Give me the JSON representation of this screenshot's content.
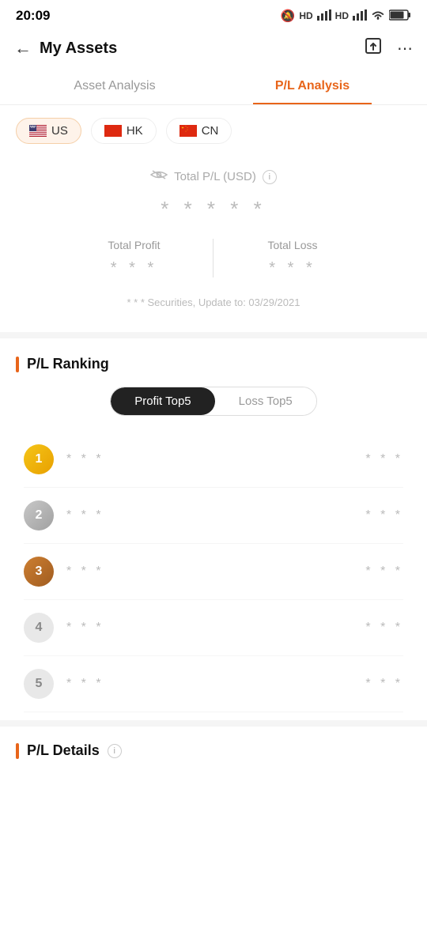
{
  "statusBar": {
    "time": "20:09",
    "icons": "🔕 HD HD ▲▲▲ ▲▲▲ ⊙ 71"
  },
  "header": {
    "title": "My Assets",
    "backLabel": "←",
    "shareIcon": "share",
    "moreIcon": "more"
  },
  "tabs": [
    {
      "id": "asset-analysis",
      "label": "Asset Analysis",
      "active": false
    },
    {
      "id": "pl-analysis",
      "label": "P/L Analysis",
      "active": true
    }
  ],
  "marketSelector": {
    "items": [
      {
        "id": "US",
        "label": "US",
        "active": true
      },
      {
        "id": "HK",
        "label": "HK",
        "active": false
      },
      {
        "id": "CN",
        "label": "CN",
        "active": false
      }
    ]
  },
  "plSummary": {
    "totalLabel": "Total P/L (USD)",
    "totalValue": "★ ★ ★ ★ ★",
    "hiddenDots": "* * * * *",
    "totalProfit": {
      "label": "Total Profit",
      "value": "* * *"
    },
    "totalLoss": {
      "label": "Total Loss",
      "value": "* * *"
    },
    "updateNote": "* * * Securities, Update to: 03/29/2021"
  },
  "ranking": {
    "sectionTitle": "P/L Ranking",
    "toggleOptions": [
      {
        "label": "Profit Top5",
        "active": true
      },
      {
        "label": "Loss Top5",
        "active": false
      }
    ],
    "items": [
      {
        "rank": 1,
        "name": "* * *",
        "value": "* * *",
        "rankClass": "rank-1"
      },
      {
        "rank": 2,
        "name": "* * *",
        "value": "* * *",
        "rankClass": "rank-2"
      },
      {
        "rank": 3,
        "name": "* * *",
        "value": "* * *",
        "rankClass": "rank-3"
      },
      {
        "rank": 4,
        "name": "* * *",
        "value": "* * *",
        "rankClass": "rank-4"
      },
      {
        "rank": 5,
        "name": "* * *",
        "value": "* * *",
        "rankClass": "rank-5"
      }
    ]
  },
  "plDetails": {
    "sectionTitle": "P/L Details"
  },
  "colors": {
    "accent": "#E8651A",
    "rank1": "#F5C518",
    "rank2": "#C8C8C8",
    "rank3": "#CD7F32"
  }
}
